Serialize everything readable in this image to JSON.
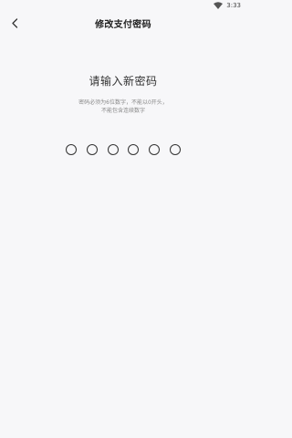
{
  "status_bar": {
    "time": "3:33",
    "wifi_icon": "wifi-icon"
  },
  "header": {
    "back_icon": "chevron-left-icon",
    "title": "修改支付密码"
  },
  "main": {
    "prompt": "请输入新密码",
    "hint_line1": "密码必须为6位数字，不能以0开头，",
    "hint_line2": "不能包含连续数字",
    "pin_length": 6,
    "pin_entered": 0
  }
}
